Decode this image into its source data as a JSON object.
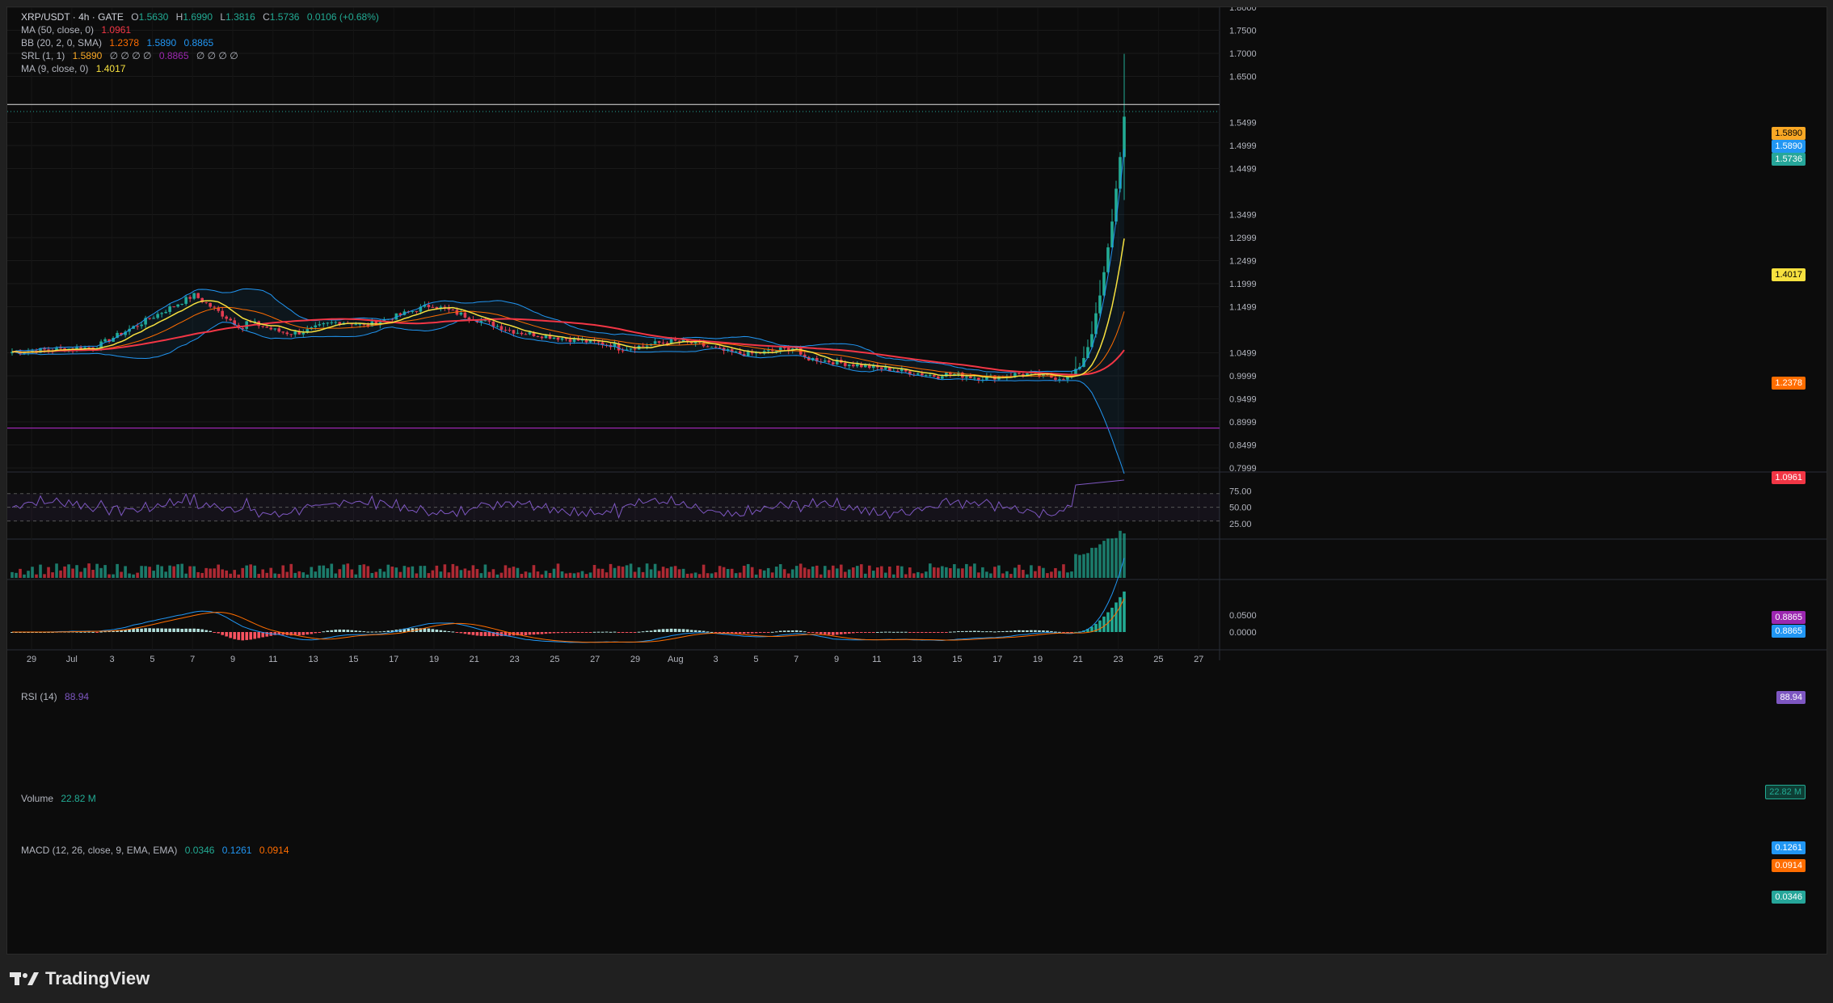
{
  "legend": {
    "symbol": "XRP/USDT · 4h · GATE",
    "ohlc": {
      "open_label": "O",
      "open": "1.5630",
      "high_label": "H",
      "high": "1.6990",
      "low_label": "L",
      "low": "1.3816",
      "close_label": "C",
      "close": "1.5736",
      "change": "0.0106 (+0.68%)"
    },
    "ma50": {
      "label": "MA (50, close, 0)",
      "value": "1.0961"
    },
    "bb": {
      "label": "BB (20, 2, 0, SMA)",
      "basis": "1.2378",
      "upper": "1.5890",
      "lower": "0.8865"
    },
    "srl": {
      "label": "SRL (1, 1)",
      "v1": "1.5890",
      "empty1": "∅ ∅ ∅ ∅",
      "v2": "0.8865",
      "empty2": "∅ ∅ ∅ ∅"
    },
    "ma9": {
      "label": "MA (9, close, 0)",
      "value": "1.4017"
    }
  },
  "price_axis": [
    "1.8000",
    "1.7500",
    "1.7000",
    "1.6500",
    "1.5499",
    "1.4999",
    "1.4499",
    "1.3499",
    "1.2999",
    "1.2499",
    "1.1999",
    "1.1499",
    "1.0499",
    "0.9999",
    "0.9499",
    "0.8999",
    "0.8499",
    "0.7999"
  ],
  "price_tags": {
    "srl_upper": "1.5890",
    "bb_upper": "1.5890",
    "close": "1.5736",
    "ma9": "1.4017",
    "bb_basis": "1.2378",
    "ma50": "1.0961",
    "srl_lower": "0.8865",
    "bb_lower": "0.8865"
  },
  "rsi": {
    "label": "RSI (14)",
    "value": "88.94",
    "axis": [
      "75.00",
      "50.00",
      "25.00"
    ],
    "tag": "88.94"
  },
  "volume": {
    "label": "Volume",
    "value": "22.82 M",
    "tag": "22.82 M"
  },
  "macd": {
    "label": "MACD (12, 26, close, 9, EMA, EMA)",
    "hist": "0.0346",
    "macd": "0.1261",
    "signal": "0.0914",
    "axis": [
      "0.0500",
      "0.0000"
    ],
    "tags": {
      "macd": "0.1261",
      "signal": "0.0914",
      "hist": "0.0346"
    }
  },
  "time_axis": [
    "29",
    "Jul",
    "3",
    "5",
    "7",
    "9",
    "11",
    "13",
    "15",
    "17",
    "19",
    "21",
    "23",
    "25",
    "27",
    "29",
    "Aug",
    "3",
    "5",
    "7",
    "9",
    "11",
    "13",
    "15",
    "17",
    "19",
    "21",
    "23",
    "25",
    "27"
  ],
  "footer": {
    "brand": "TradingView"
  },
  "colors": {
    "up": "#22ab94",
    "down": "#f23645",
    "ma50": "#f23645",
    "ma9": "#f7e13f",
    "bb_basis": "#ff6d00",
    "bb_band": "#2962ff",
    "srl_lower": "#9c27b0",
    "rsi": "#7e57c2",
    "macd_line": "#2962ff",
    "signal_line": "#ff6d00",
    "close_tag": "#26a69a",
    "srl_tag": "#f9a825"
  }
}
